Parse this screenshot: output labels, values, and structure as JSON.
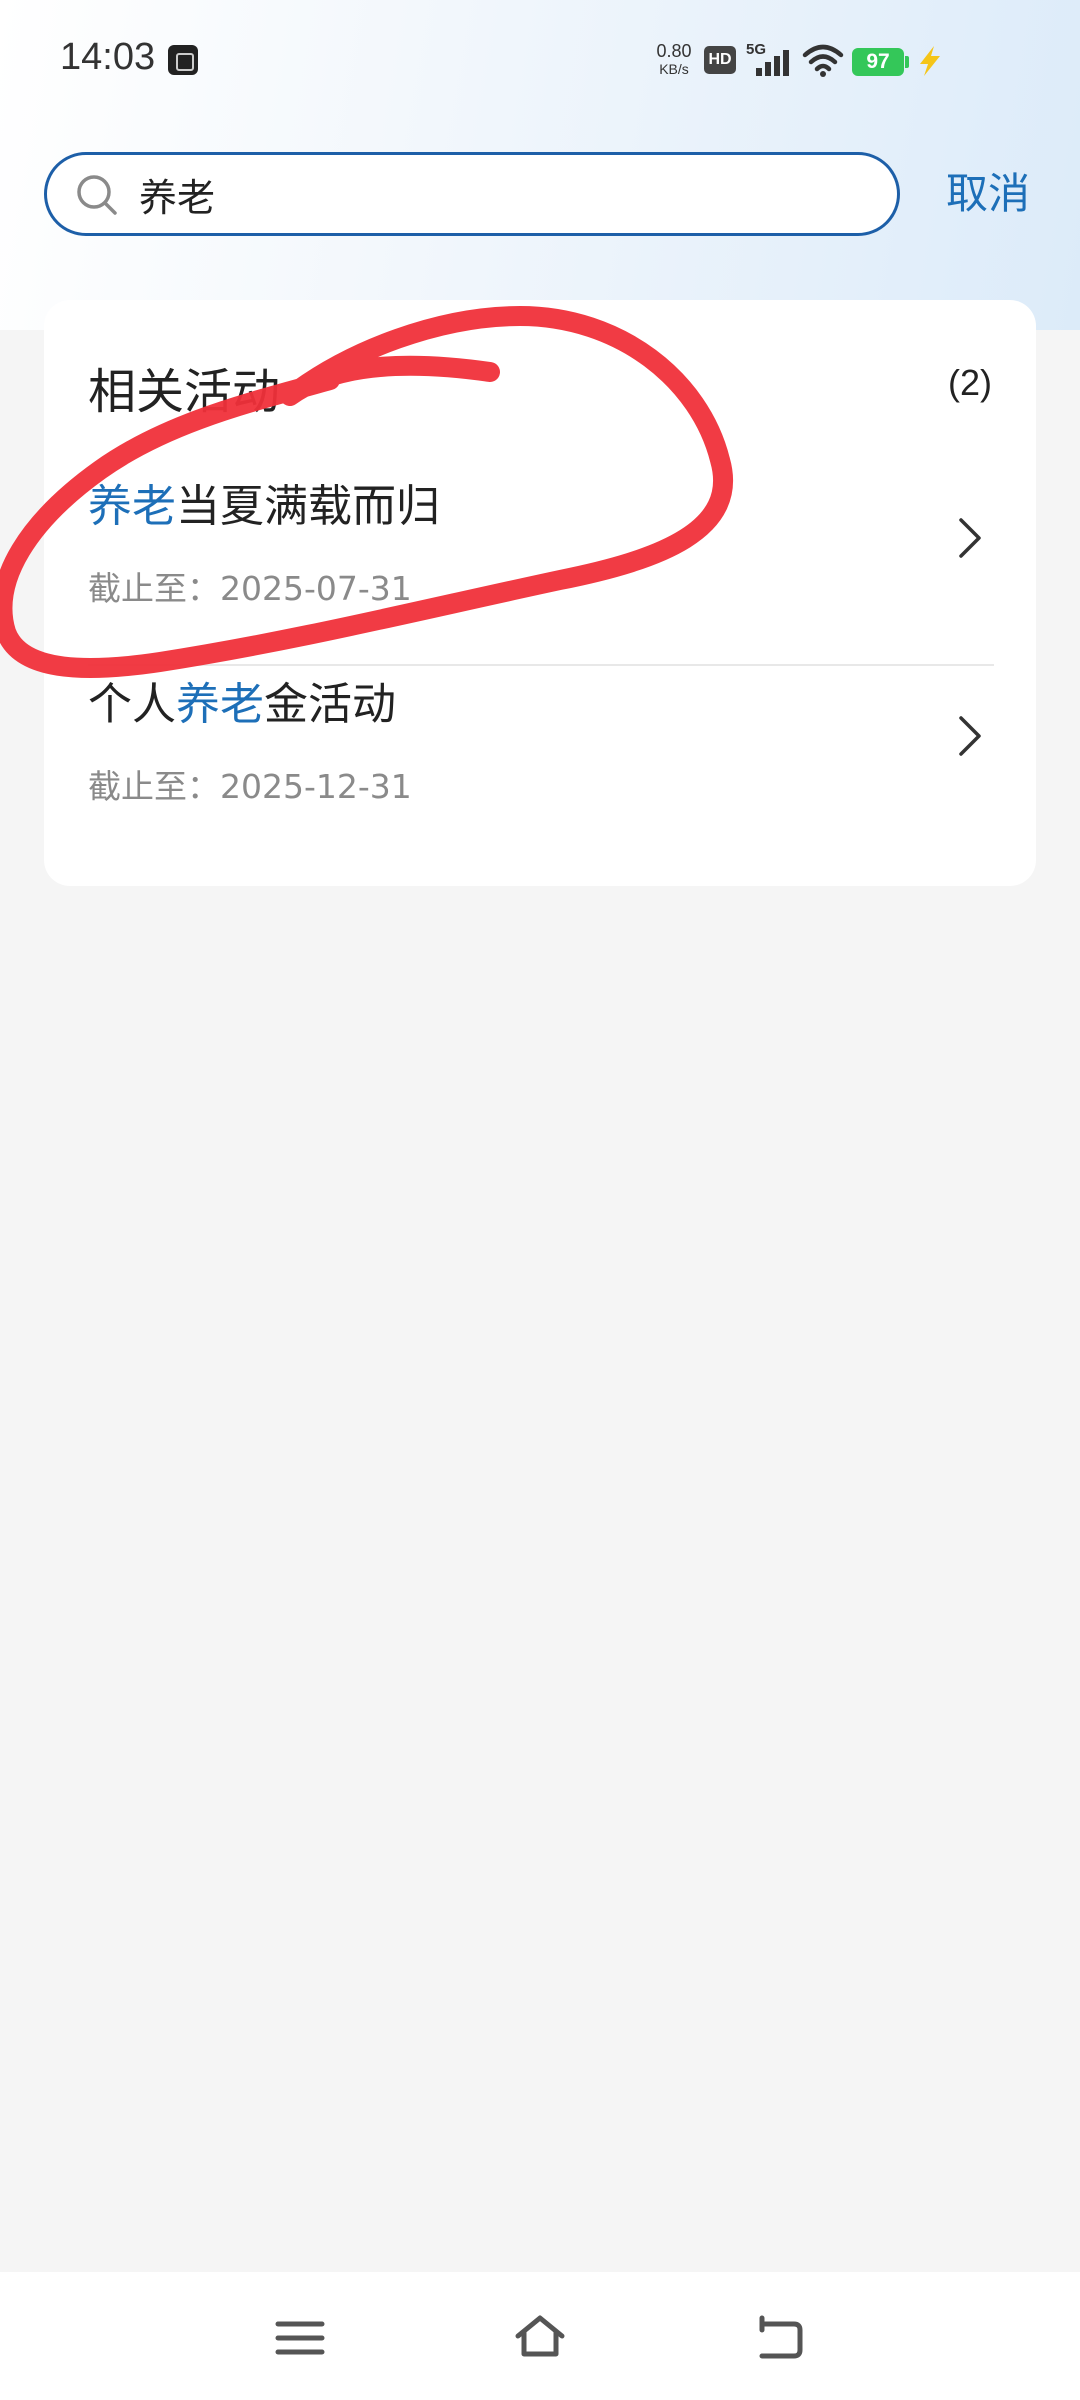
{
  "status_bar": {
    "time": "14:03",
    "net_speed_value": "0.80",
    "net_speed_unit": "KB/s",
    "hd_label": "HD",
    "network": "5G",
    "battery": "97",
    "battery_color": "#34c759",
    "icons": [
      "app-notification-icon",
      "hd-icon",
      "signal-icon",
      "wifi-icon",
      "battery-icon",
      "charging-icon"
    ]
  },
  "search": {
    "value": "养老",
    "cancel_label": "取消",
    "accent_color": "#1d6fb8"
  },
  "results": {
    "section_title": "相关活动",
    "count": "(2)",
    "items": [
      {
        "highlight": "养老",
        "rest": "当夏满载而归",
        "deadline_label": "截止至：",
        "deadline": "2025-07-31"
      },
      {
        "prefix": "个人",
        "highlight": "养老",
        "rest": "金活动",
        "deadline_label": "截止至：",
        "deadline": "2025-12-31"
      }
    ]
  },
  "nav_bar": {
    "icons": [
      "menu-icon",
      "home-icon",
      "back-icon"
    ]
  }
}
